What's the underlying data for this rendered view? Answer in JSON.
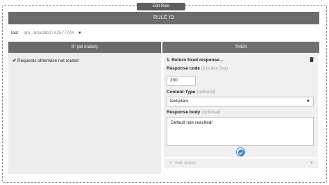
{
  "dialog": {
    "title": "Edit Rule"
  },
  "rule_id_header": "RULE ID",
  "arn_row": {
    "label": "last",
    "value": "arn...b0a28b1742577744"
  },
  "if_panel": {
    "header": "IF (all match)",
    "conditions": [
      {
        "label": "Requests otherwise not routed"
      }
    ]
  },
  "then_panel": {
    "header": "THEN",
    "action": {
      "title": "1. Return fixed response...",
      "response_code_label": "Response code",
      "response_code_hint": "(2xx,4xx,5xx)",
      "response_code_value": "200",
      "content_type_label": "Content-Type",
      "content_type_hint": "(optional)",
      "content_type_value": "text/plain",
      "response_body_label": "Response body",
      "response_body_hint": "(optional)",
      "response_body_value": "Default rule reached!"
    },
    "add_action_label": "Add action"
  }
}
